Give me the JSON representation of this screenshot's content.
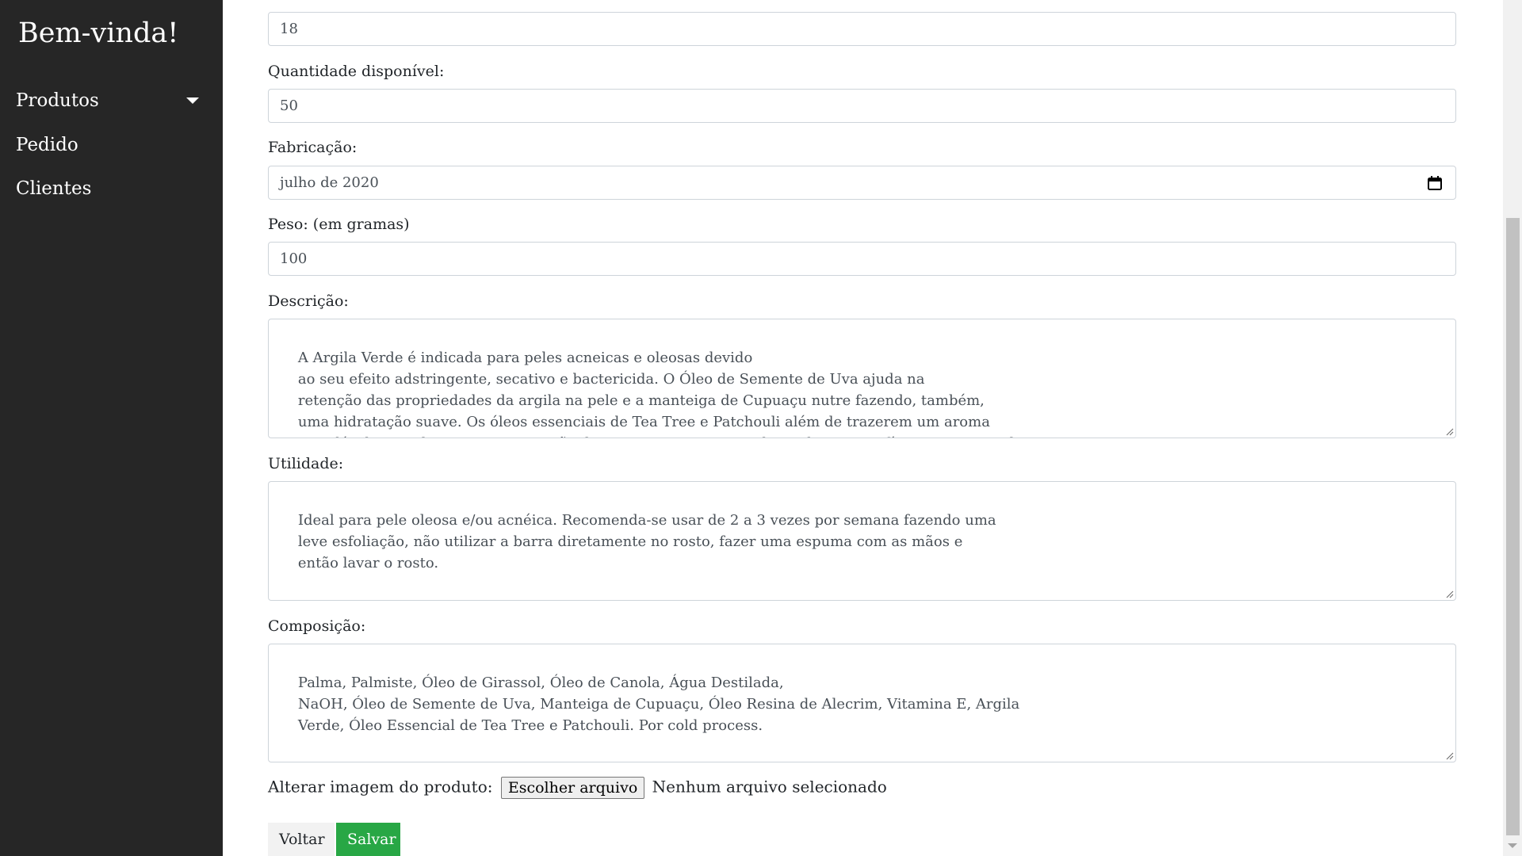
{
  "sidebar": {
    "brand": "Bem-vinda!",
    "items": [
      {
        "label": "Produtos"
      },
      {
        "label": "Pedido"
      },
      {
        "label": "Clientes"
      }
    ]
  },
  "form": {
    "price_value": "18",
    "quantity_label": "Quantidade disponível:",
    "quantity_value": "50",
    "manufacture_label": "Fabricação:",
    "manufacture_value": "julho de 2020",
    "weight_label": "Peso: (em gramas)",
    "weight_value": "100",
    "description_label": "Descrição:",
    "description_value": "A Argila Verde é indicada para peles acneicas e oleosas devido\n    ao seu efeito adstringente, secativo e bactericida. O Óleo de Semente de Uva ajuda na\n    retenção das propriedades da argila na pele e a manteiga de Cupuaçu nutre fazendo, também,\n    uma hidratação suave. Os óleos essenciais de Tea Tree e Patchouli além de trazerem um aroma\n    agradável, contribuem na cicatrização das acnes, proporcionando um bem-estar físico e emocional.",
    "utility_label": "Utilidade:",
    "utility_value": "Ideal para pele oleosa e/ou acnéica. Recomenda-se usar de 2 a 3 vezes por semana fazendo uma\n    leve esfoliação, não utilizar a barra diretamente no rosto, fazer uma espuma com as mãos e\n    então lavar o rosto.",
    "composition_label": "Composição:",
    "composition_value": "Palma, Palmiste, Óleo de Girassol, Óleo de Canola, Água Destilada,\n    NaOH, Óleo de Semente de Uva, Manteiga de Cupuaçu, Óleo Resina de Alecrim, Vitamina E, Argila\n    Verde, Óleo Essencial de Tea Tree e Patchouli. Por cold process.",
    "image_label": "Alterar imagem do produto:",
    "file_button": "Escolher arquivo",
    "file_status": "Nenhum arquivo selecionado"
  },
  "actions": {
    "back_label": "Voltar",
    "save_label": "Salvar"
  },
  "colors": {
    "sidebar_bg": "#262626",
    "save_button": "#28a745"
  },
  "icons": {
    "calendar": "calendar-icon",
    "dropdown": "caret-down-icon"
  }
}
